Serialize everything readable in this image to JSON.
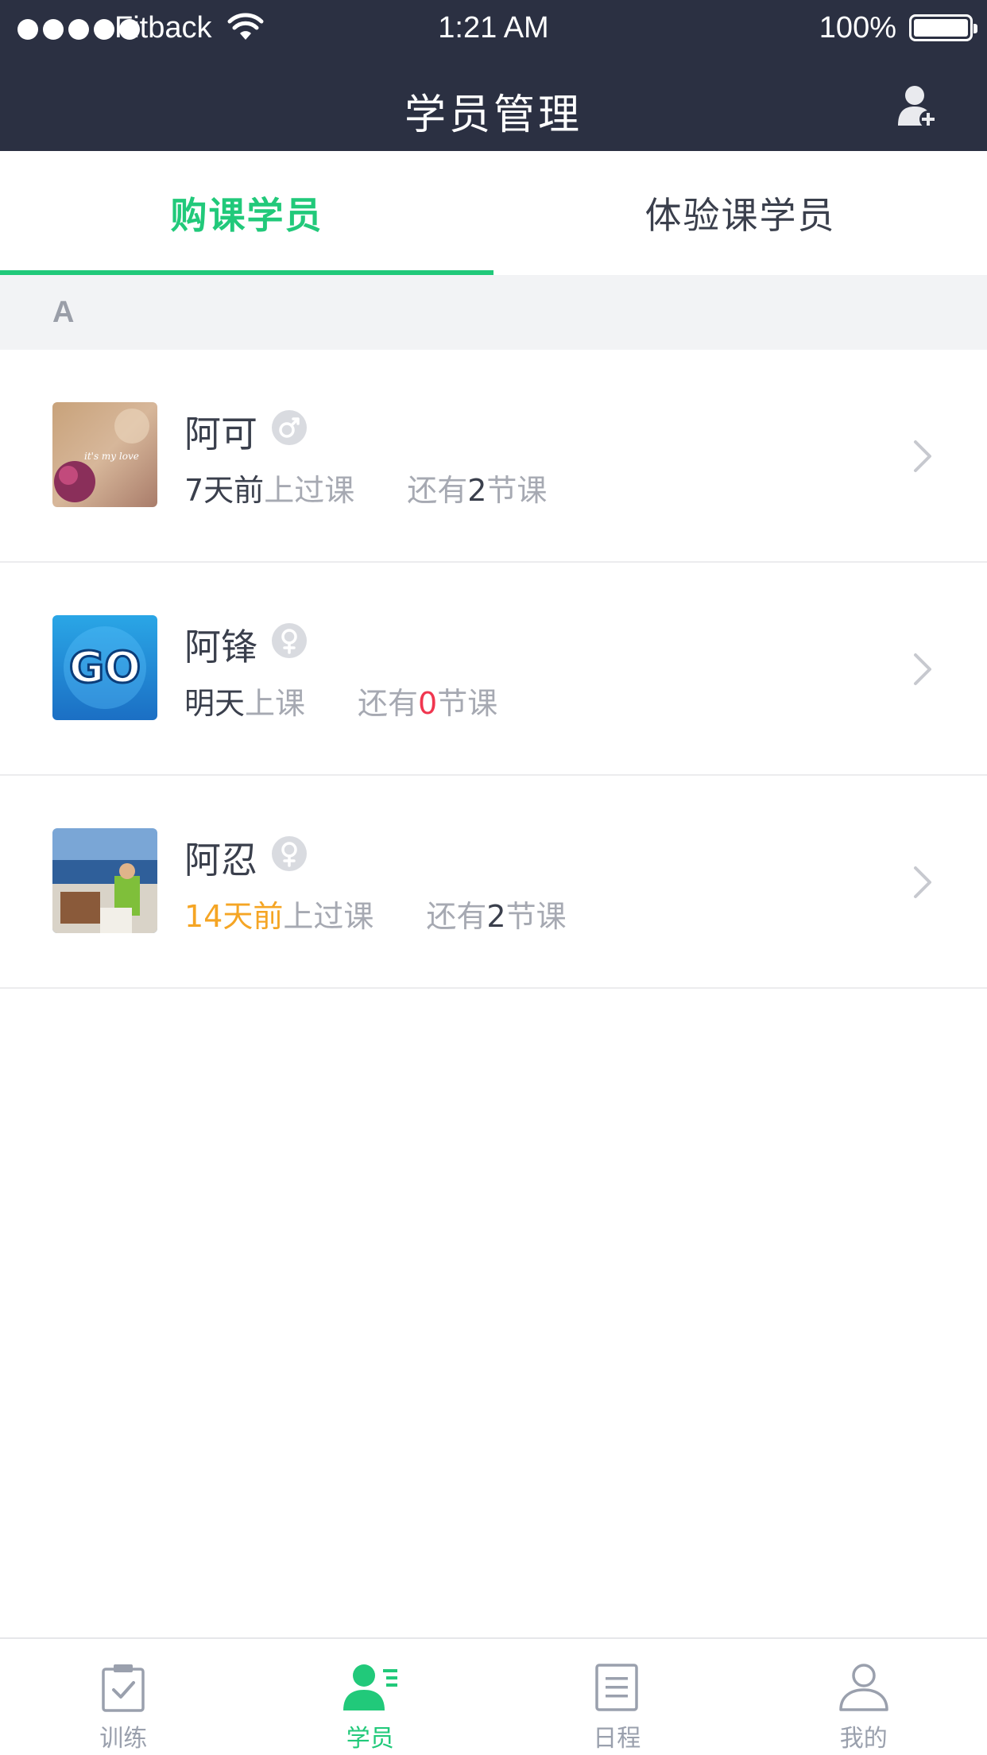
{
  "status_bar": {
    "carrier": "Fitback",
    "time": "1:21 AM",
    "battery": "100%"
  },
  "nav": {
    "title": "学员管理",
    "icon": "add-user-icon"
  },
  "tabs": [
    {
      "label": "购课学员",
      "active": true
    },
    {
      "label": "体验课学员",
      "active": false
    }
  ],
  "section": {
    "letter": "A"
  },
  "students": [
    {
      "name": "阿可",
      "gender": "male",
      "last_time": "7天前",
      "last_suffix": "上过课",
      "remain_prefix": "还有",
      "remain_count": "2",
      "remain_suffix": "节课"
    },
    {
      "name": "阿锋",
      "gender": "female",
      "last_time": "明天",
      "last_suffix": "上课",
      "remain_prefix": "还有",
      "remain_count": "0",
      "remain_suffix": "节课"
    },
    {
      "name": "阿忍",
      "gender": "female",
      "last_time": "14天前",
      "last_suffix": "上过课",
      "remain_prefix": "还有",
      "remain_count": "2",
      "remain_suffix": "节课"
    }
  ],
  "tabbar": [
    {
      "label": "训练",
      "icon": "clipboard-check-icon",
      "active": false
    },
    {
      "label": "学员",
      "icon": "students-icon",
      "active": true
    },
    {
      "label": "日程",
      "icon": "schedule-icon",
      "active": false
    },
    {
      "label": "我的",
      "icon": "profile-icon",
      "active": false
    }
  ],
  "colors": {
    "nav_bg": "#2b3042",
    "accent": "#21c97a",
    "warning": "#f5a524",
    "danger": "#f0364f"
  }
}
